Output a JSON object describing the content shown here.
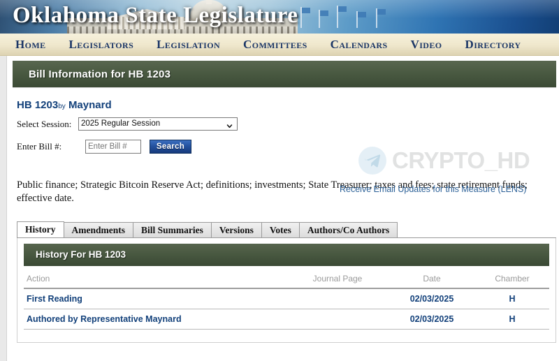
{
  "banner": {
    "site_title": "Oklahoma State Legislature"
  },
  "nav": {
    "items": [
      {
        "label": "Home",
        "name": "nav-home"
      },
      {
        "label": "Legislators",
        "name": "nav-legislators"
      },
      {
        "label": "Legislation",
        "name": "nav-legislation"
      },
      {
        "label": "Committees",
        "name": "nav-committees"
      },
      {
        "label": "Calendars",
        "name": "nav-calendars"
      },
      {
        "label": "Video",
        "name": "nav-video"
      },
      {
        "label": "Directory",
        "name": "nav-directory"
      }
    ]
  },
  "page_header": {
    "title": "Bill Information for HB 1203"
  },
  "bill": {
    "number": "HB 1203",
    "by_word": "by",
    "author": "Maynard",
    "description": "Public finance; Strategic Bitcoin Reserve Act; definitions; investments; State Treasurer; taxes and fees; state retirement funds; effective date."
  },
  "search_form": {
    "session_label": "Select Session:",
    "session_value": "2025 Regular Session",
    "session_options": [
      "2025 Regular Session"
    ],
    "bill_label": "Enter Bill #:",
    "bill_placeholder": "Enter Bill #",
    "bill_value": "",
    "search_button": "Search",
    "chevron_icon": "chevron-down-icon"
  },
  "lens": {
    "link_text": "Receive Email Updates for this Measure (LENS)",
    "link_color": "#2a5f96"
  },
  "watermark": {
    "text": "CRYPTO_HD",
    "logo_icon": "telegram-icon"
  },
  "tabs": [
    {
      "label": "History",
      "active": true
    },
    {
      "label": "Amendments",
      "active": false
    },
    {
      "label": "Bill Summaries",
      "active": false
    },
    {
      "label": "Versions",
      "active": false
    },
    {
      "label": "Votes",
      "active": false
    },
    {
      "label": "Authors/Co Authors",
      "active": false
    }
  ],
  "history_panel": {
    "title": "History For HB 1203",
    "columns": [
      "Action",
      "Journal Page",
      "Date",
      "Chamber"
    ],
    "rows": [
      {
        "action": "First Reading",
        "journal_page": "",
        "date": "02/03/2025",
        "chamber": "H"
      },
      {
        "action": "Authored by Representative Maynard",
        "journal_page": "",
        "date": "02/03/2025",
        "chamber": "H"
      }
    ]
  },
  "colors": {
    "nav_text": "#1b3666",
    "green_bar": "#4a5a42",
    "link_blue": "#12407a",
    "button_blue": "#24529f"
  }
}
